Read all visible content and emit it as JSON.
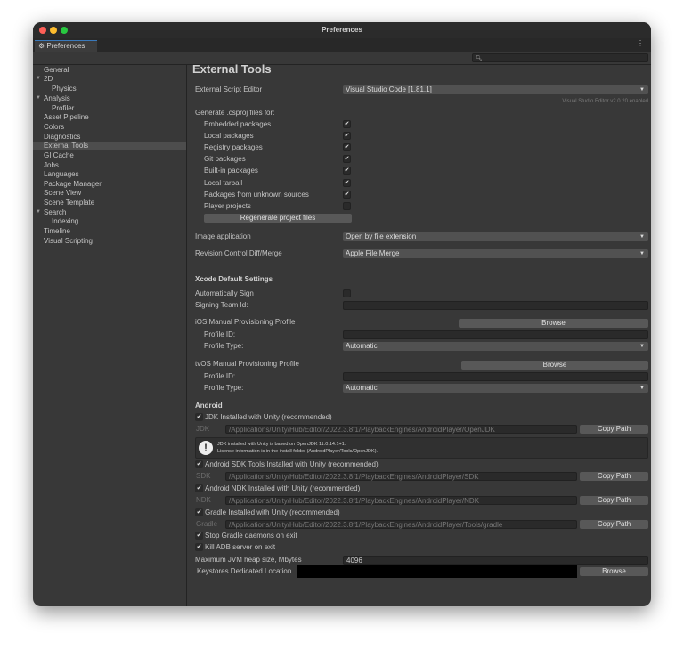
{
  "window": {
    "title": "Preferences",
    "tab": "Preferences",
    "search_placeholder": ""
  },
  "sidebar": {
    "items": [
      {
        "label": "General"
      },
      {
        "label": "2D"
      },
      {
        "label": "Physics"
      },
      {
        "label": "Analysis"
      },
      {
        "label": "Profiler"
      },
      {
        "label": "Asset Pipeline"
      },
      {
        "label": "Colors"
      },
      {
        "label": "Diagnostics"
      },
      {
        "label": "External Tools",
        "selected": true
      },
      {
        "label": "GI Cache"
      },
      {
        "label": "Jobs"
      },
      {
        "label": "Languages"
      },
      {
        "label": "Package Manager"
      },
      {
        "label": "Scene View"
      },
      {
        "label": "Scene Template"
      },
      {
        "label": "Search"
      },
      {
        "label": "Indexing"
      },
      {
        "label": "Timeline"
      },
      {
        "label": "Visual Scripting"
      }
    ]
  },
  "main": {
    "title": "External Tools",
    "script_editor_label": "External Script Editor",
    "script_editor_value": "Visual Studio Code [1.81.1]",
    "editor_status": "Visual Studio Editor v2.0.20 enabled",
    "generate_label": "Generate .csproj files for:",
    "csproj": [
      {
        "label": "Embedded packages",
        "checked": true
      },
      {
        "label": "Local packages",
        "checked": true
      },
      {
        "label": "Registry packages",
        "checked": true
      },
      {
        "label": "Git packages",
        "checked": true
      },
      {
        "label": "Built-in packages",
        "checked": true
      },
      {
        "label": "Local tarball",
        "checked": true
      },
      {
        "label": "Packages from unknown sources",
        "checked": true
      },
      {
        "label": "Player projects",
        "checked": false
      }
    ],
    "regenerate": "Regenerate project files",
    "image_app_label": "Image application",
    "image_app_value": "Open by file extension",
    "revision_label": "Revision Control Diff/Merge",
    "revision_value": "Apple File Merge",
    "xcode": {
      "title": "Xcode Default Settings",
      "auto_sign": "Automatically Sign",
      "team_id": "Signing Team Id:",
      "ios": "iOS Manual Provisioning Profile",
      "tvos": "tvOS Manual Provisioning Profile",
      "browse": "Browse",
      "profile_id": "Profile ID:",
      "profile_type": "Profile Type:",
      "profile_type_value": "Automatic"
    },
    "android": {
      "title": "Android",
      "jdk_check": "JDK Installed with Unity (recommended)",
      "jdk_label": "JDK",
      "jdk_path": "/Applications/Unity/Hub/Editor/2022.3.8f1/PlaybackEngines/AndroidPlayer/OpenJDK",
      "info1": "JDK installed with Unity is based on OpenJDK 11.0.14.1+1.",
      "info2": "License information is in the install folder (AndroidPlayer/Tools/OpenJDK).",
      "sdk_check": "Android SDK Tools Installed with Unity (recommended)",
      "sdk_label": "SDK",
      "sdk_path": "/Applications/Unity/Hub/Editor/2022.3.8f1/PlaybackEngines/AndroidPlayer/SDK",
      "ndk_check": "Android NDK Installed with Unity (recommended)",
      "ndk_label": "NDK",
      "ndk_path": "/Applications/Unity/Hub/Editor/2022.3.8f1/PlaybackEngines/AndroidPlayer/NDK",
      "gradle_check": "Gradle Installed with Unity (recommended)",
      "gradle_label": "Gradle",
      "gradle_path": "/Applications/Unity/Hub/Editor/2022.3.8f1/PlaybackEngines/AndroidPlayer/Tools/gradle",
      "copy_path": "Copy Path",
      "stop_gradle": "Stop Gradle daemons on exit",
      "kill_adb": "Kill ADB server on exit",
      "jvm_label": "Maximum JVM heap size, Mbytes",
      "jvm_value": "4096",
      "keystore_label": "Keystores Dedicated Location",
      "browse": "Browse"
    }
  },
  "check_glyph": "✔"
}
